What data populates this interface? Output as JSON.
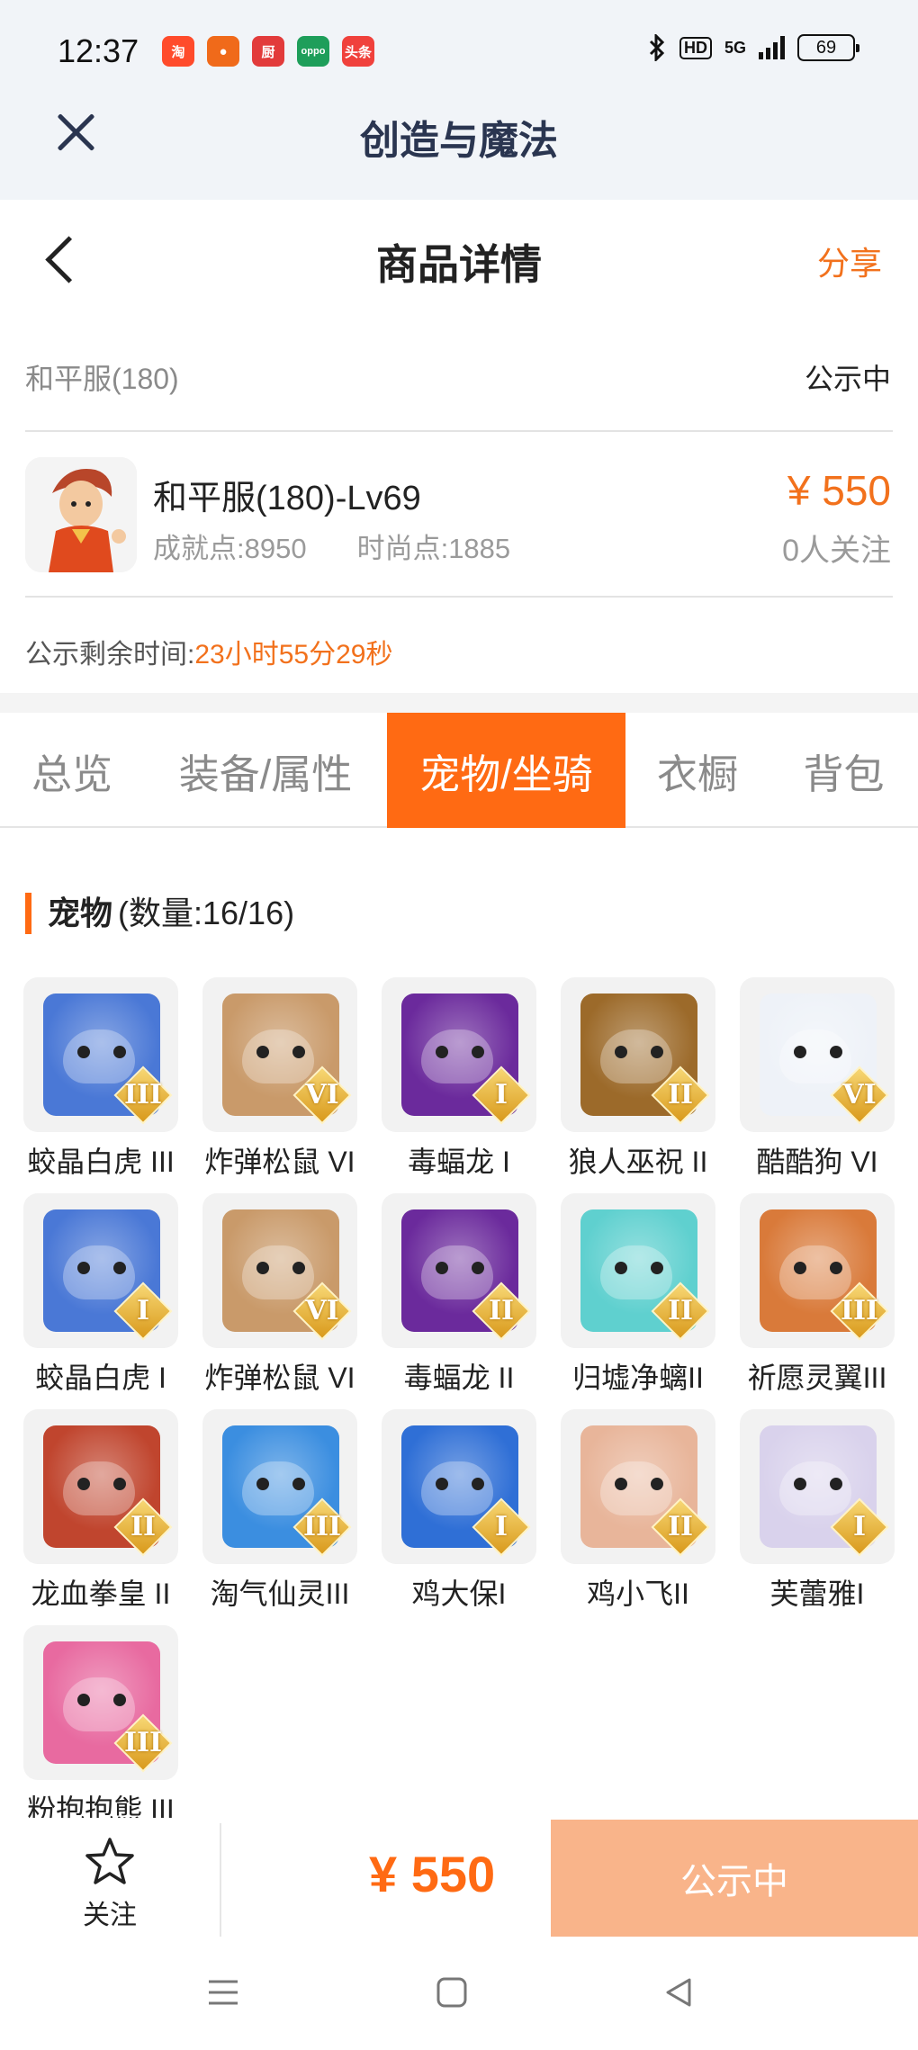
{
  "status_bar": {
    "time": "12:37",
    "apps": [
      {
        "icon": "taobao-icon",
        "label": "淘",
        "color": "#ff4b2b"
      },
      {
        "icon": "app-orange-icon",
        "label": "●",
        "color": "#f06a1a"
      },
      {
        "icon": "xiachufang-icon",
        "label": "厨",
        "color": "#e23b3b"
      },
      {
        "icon": "oppo-store-icon",
        "label": "oppo",
        "color": "#1e9e5a"
      },
      {
        "icon": "toutiao-icon",
        "label": "头条",
        "color": "#f0413c"
      }
    ],
    "hd": "HD",
    "network": "5G",
    "battery": "69"
  },
  "webview": {
    "title": "创造与魔法"
  },
  "header": {
    "title": "商品详情",
    "share_label": "分享"
  },
  "listing": {
    "server": "和平服(180)",
    "status": "公示中",
    "character_name": "和平服(180)-Lv69",
    "achievement": "成就点:8950",
    "fashion": "时尚点:1885",
    "price": "¥ 550",
    "followers": "0人关注",
    "timer_label": "公示剩余时间:",
    "timer_value": "23小时55分29秒"
  },
  "tabs": [
    {
      "label": "总览",
      "active": false
    },
    {
      "label": "装备/属性",
      "active": false
    },
    {
      "label": "宠物/坐骑",
      "active": true
    },
    {
      "label": "衣橱",
      "active": false
    },
    {
      "label": "背包",
      "active": false
    }
  ],
  "pets_section": {
    "title": "宠物",
    "count": "(数量:16/16)"
  },
  "pets": [
    {
      "name": "蛟晶白虎 III",
      "rank": "III",
      "color": "#4a78d6",
      "icon": "white-tiger-icon"
    },
    {
      "name": "炸弹松鼠 VI",
      "rank": "VI",
      "color": "#c99a6a",
      "icon": "squirrel-icon"
    },
    {
      "name": "毒蝠龙 I",
      "rank": "I",
      "color": "#6b2a9c",
      "icon": "bat-dragon-icon"
    },
    {
      "name": "狼人巫祝 II",
      "rank": "II",
      "color": "#9c6a2a",
      "icon": "werewolf-icon"
    },
    {
      "name": "酷酷狗 VI",
      "rank": "VI",
      "color": "#eef2f8",
      "icon": "cool-dog-icon"
    },
    {
      "name": "蛟晶白虎 I",
      "rank": "I",
      "color": "#4a78d6",
      "icon": "white-tiger-icon"
    },
    {
      "name": "炸弹松鼠 VI",
      "rank": "VI",
      "color": "#c99a6a",
      "icon": "squirrel-icon"
    },
    {
      "name": "毒蝠龙 II",
      "rank": "II",
      "color": "#6b2a9c",
      "icon": "bat-dragon-icon"
    },
    {
      "name": "归墟净螭II",
      "rank": "II",
      "color": "#5fd0cf",
      "icon": "water-dragon-icon"
    },
    {
      "name": "祈愿灵翼III",
      "rank": "III",
      "color": "#d97a3a",
      "icon": "griffin-icon"
    },
    {
      "name": "龙血拳皇 II",
      "rank": "II",
      "color": "#c0452e",
      "icon": "ram-fighter-icon"
    },
    {
      "name": "淘气仙灵III",
      "rank": "III",
      "color": "#3b8ee0",
      "icon": "blue-pup-icon"
    },
    {
      "name": "鸡大保I",
      "rank": "I",
      "color": "#2f6fd6",
      "icon": "blue-chicken-icon"
    },
    {
      "name": "鸡小飞II",
      "rank": "II",
      "color": "#e8b59a",
      "icon": "chick-icon"
    },
    {
      "name": "芙蕾雅I",
      "rank": "I",
      "color": "#d9d2ec",
      "icon": "valkyrie-icon"
    },
    {
      "name": "粉抱抱熊 III",
      "rank": "III",
      "color": "#e86aa0",
      "icon": "pink-bear-icon"
    }
  ],
  "bottom_bar": {
    "follow_label": "关注",
    "price": "¥ 550",
    "action_label": "公示中"
  },
  "colors": {
    "accent": "#ff6a13",
    "price": "#f2711c",
    "cta_disabled": "#f9b48a"
  }
}
